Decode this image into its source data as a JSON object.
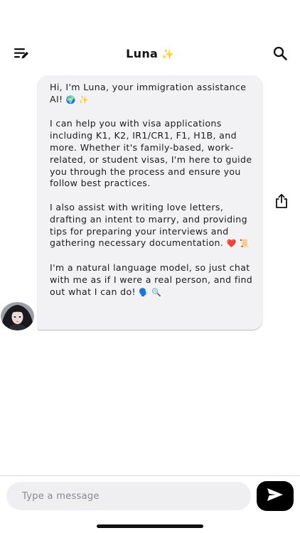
{
  "header": {
    "title": "Luna",
    "title_emoji": "✨",
    "menu_icon": "list-edit-icon",
    "search_icon": "search-icon"
  },
  "message": {
    "paragraphs": [
      {
        "text": "Hi, I'm Luna, your immigration assistance AI!",
        "emoji": "🌍 ✨"
      },
      {
        "text": "I can help you with visa applications including K1, K2, IR1/CR1, F1, H1B, and more. Whether it's family-based, work-related, or student visas, I'm here to guide you through the process and ensure you follow best practices.",
        "emoji": ""
      },
      {
        "text": "I also assist with writing love letters, drafting an intent to marry, and providing tips for preparing your interviews and gathering necessary documentation.",
        "emoji": "❤️ 📜"
      },
      {
        "text": "I'm a natural language model, so just chat with me as if I were a real person, and find out what I can do!",
        "emoji": "🗣️ 🔍"
      }
    ]
  },
  "actions": {
    "share_icon": "share-icon"
  },
  "composer": {
    "placeholder": "Type a message",
    "value": "",
    "send_icon": "send-icon"
  },
  "colors": {
    "bubble": "#f2f2f4",
    "input": "#efeff1",
    "send_button": "#000000",
    "accent_sparkle": "#f2c23a"
  }
}
